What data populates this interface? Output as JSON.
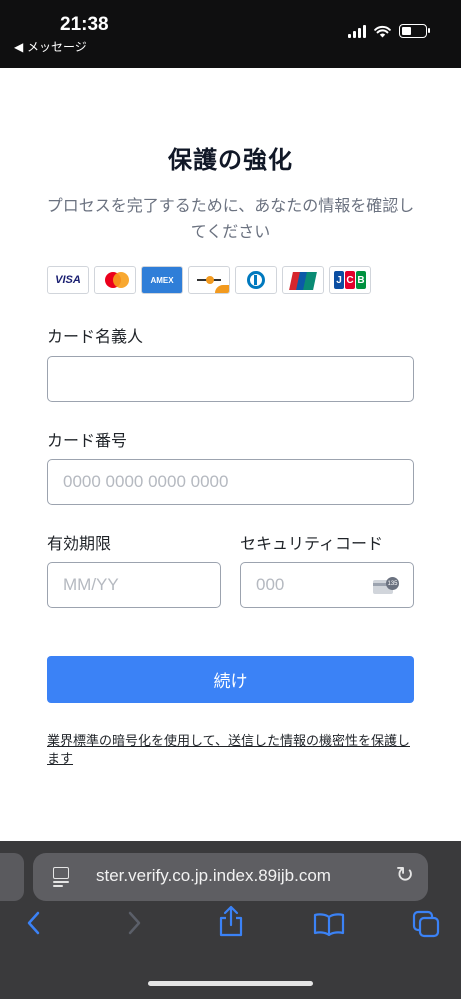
{
  "status_bar": {
    "time": "21:38",
    "back_app_label": "◀ メッセージ",
    "icons": [
      "cellular-signal-icon",
      "wifi-icon",
      "battery-icon"
    ]
  },
  "page": {
    "title": "保護の強化",
    "subtitle": "プロセスを完了するために、あなたの情報を確認してください",
    "card_brands": [
      "VISA",
      "mastercard",
      "AMEX",
      "discover",
      "diners",
      "UnionPay",
      "JCB"
    ]
  },
  "form": {
    "cardholder": {
      "label": "カード名義人",
      "placeholder": ""
    },
    "card_number": {
      "label": "カード番号",
      "placeholder": "0000 0000 0000 0000"
    },
    "expiry": {
      "label": "有効期限",
      "placeholder": "MM/YY"
    },
    "security_code": {
      "label": "セキュリティコード",
      "placeholder": "000",
      "icon_badge": "135"
    },
    "continue_label": "続け",
    "note": "業界標準の暗号化を使用して、送信した情報の機密性を保護します"
  },
  "browser": {
    "url": "ster.verify.co.jp.index.89ijb.com",
    "toolbar_icons": [
      "back-icon",
      "forward-icon",
      "share-icon",
      "bookmarks-icon",
      "tabs-icon"
    ]
  },
  "colors": {
    "accent": "#3b82f6",
    "status_bar_bg": "#0f0f10",
    "browser_bar_bg": "#3a3a3c"
  }
}
